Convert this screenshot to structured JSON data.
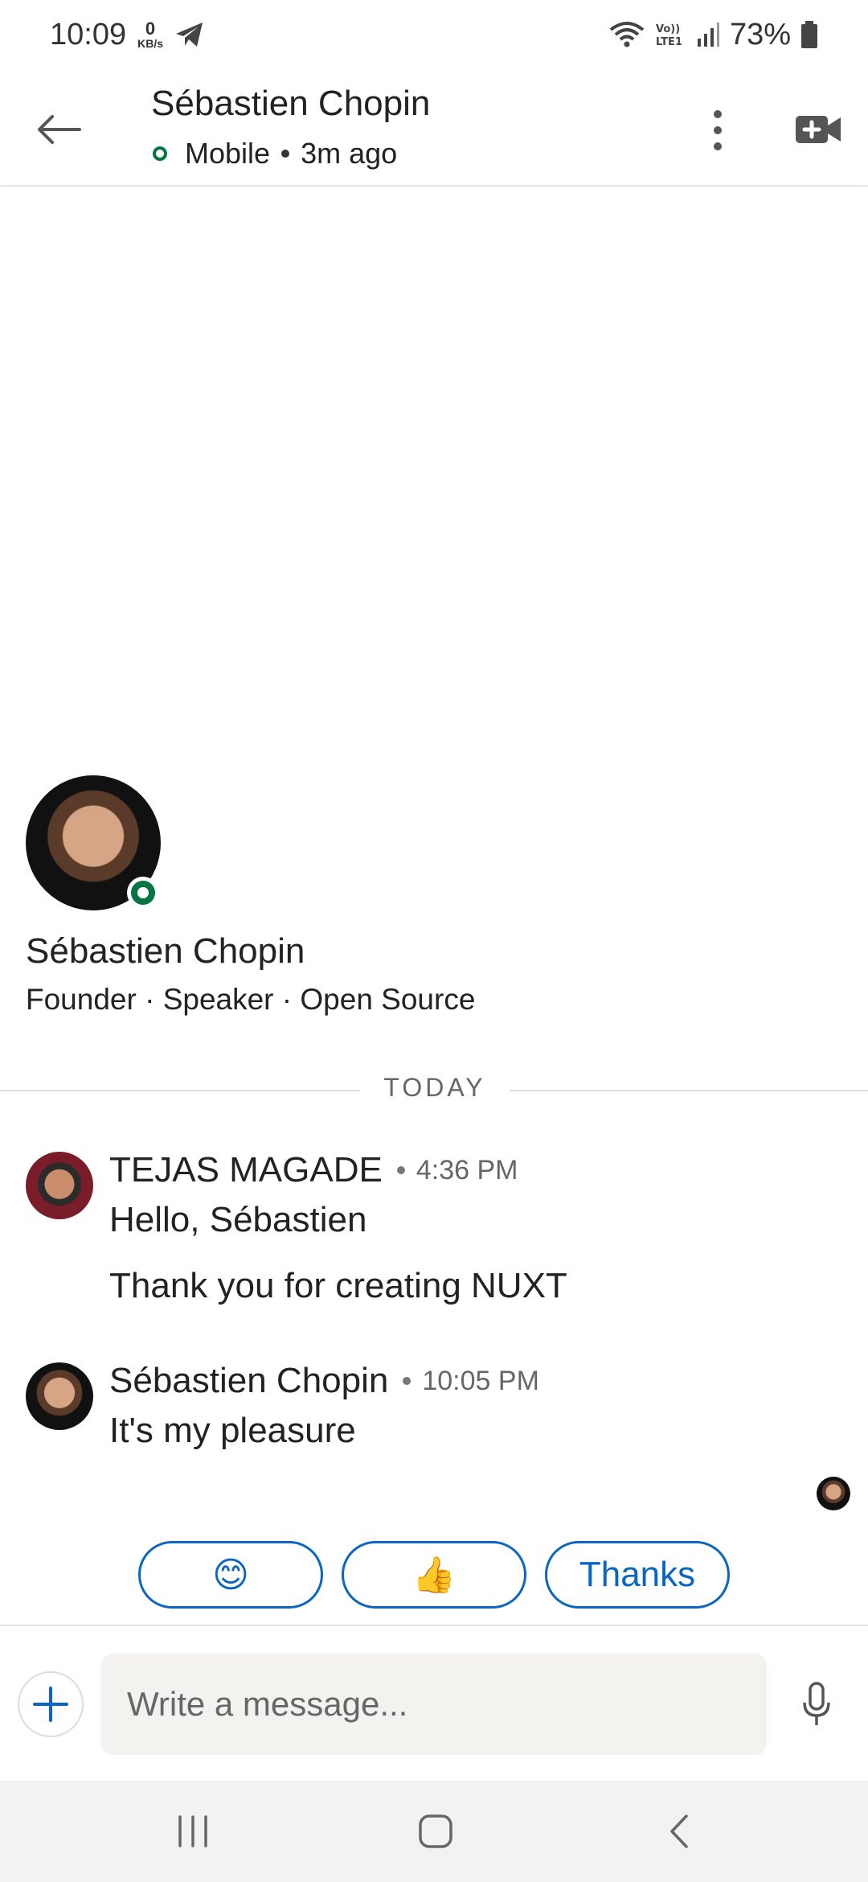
{
  "status_bar": {
    "time": "10:09",
    "net_speed_value": "0",
    "net_speed_unit": "KB/s",
    "lte_label": "Vo)) LTE1",
    "battery": "73%"
  },
  "header": {
    "contact_name": "Sébastien Chopin",
    "presence_device": "Mobile",
    "last_active": "3m ago"
  },
  "profile": {
    "name": "Sébastien Chopin",
    "headline": "Founder · Speaker · Open Source"
  },
  "date_divider": "TODAY",
  "messages": [
    {
      "sender": "TEJAS MAGADE",
      "time": "4:36 PM",
      "lines": [
        "Hello, Sébastien",
        "Thank you for creating NUXT"
      ]
    },
    {
      "sender": "Sébastien Chopin",
      "time": "10:05 PM",
      "lines": [
        "It's my pleasure"
      ]
    }
  ],
  "quick_replies": [
    "😊",
    "👍",
    "Thanks"
  ],
  "composer": {
    "placeholder": "Write a message..."
  },
  "colors": {
    "accent": "#0a66c2",
    "online": "#057642",
    "input_bg": "#f3f2ef"
  }
}
